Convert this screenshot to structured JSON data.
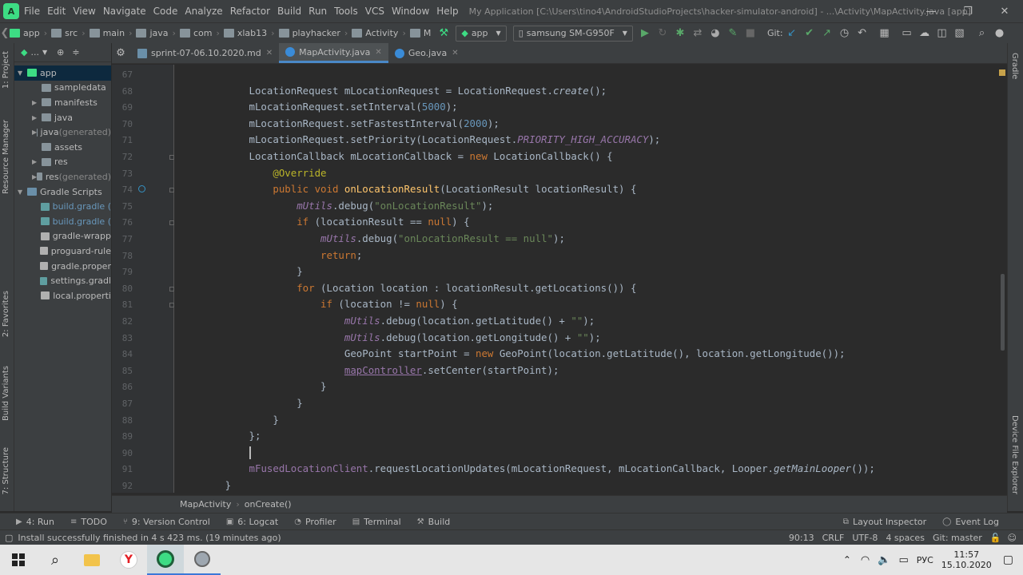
{
  "menu": [
    "File",
    "Edit",
    "View",
    "Navigate",
    "Code",
    "Analyze",
    "Refactor",
    "Build",
    "Run",
    "Tools",
    "VCS",
    "Window",
    "Help"
  ],
  "window_title": "My Application [C:\\Users\\tino4\\AndroidStudioProjects\\hacker-simulator-android] - ...\\Activity\\MapActivity.java [app]",
  "breadcrumbs": [
    "app",
    "src",
    "main",
    "java",
    "com",
    "xlab13",
    "playhacker",
    "Activity",
    "M"
  ],
  "run_config": "app",
  "device": "samsung SM-G950F",
  "git_label": "Git:",
  "project_view": "...",
  "project_tree": [
    {
      "label": "app",
      "level": 0,
      "arrow": "▼",
      "color": "#3ddc84",
      "selected": true
    },
    {
      "label": "sampledata",
      "level": 1,
      "arrow": "",
      "color": "#87939a"
    },
    {
      "label": "manifests",
      "level": 1,
      "arrow": "▶",
      "color": "#87939a"
    },
    {
      "label": "java",
      "level": 1,
      "arrow": "▶",
      "color": "#87939a"
    },
    {
      "label": "java",
      "suffix": " (generated)",
      "level": 1,
      "arrow": "▶",
      "color": "#87939a"
    },
    {
      "label": "assets",
      "level": 1,
      "arrow": "",
      "color": "#87939a"
    },
    {
      "label": "res",
      "level": 1,
      "arrow": "▶",
      "color": "#87939a"
    },
    {
      "label": "res",
      "suffix": " (generated)",
      "level": 1,
      "arrow": "▶",
      "color": "#87939a"
    },
    {
      "label": "Gradle Scripts",
      "level": 0,
      "arrow": "▼",
      "color": "#6a8fa8"
    },
    {
      "label": "build.gradle (",
      "level": 1,
      "arrow": "",
      "color": "#5f9ea0",
      "blue": true
    },
    {
      "label": "build.gradle (",
      "level": 1,
      "arrow": "",
      "color": "#5f9ea0",
      "blue": true
    },
    {
      "label": "gradle-wrapp",
      "level": 1,
      "arrow": "",
      "color": "#b0b0b0"
    },
    {
      "label": "proguard-rule",
      "level": 1,
      "arrow": "",
      "color": "#b0b0b0"
    },
    {
      "label": "gradle.proper",
      "level": 1,
      "arrow": "",
      "color": "#b0b0b0"
    },
    {
      "label": "settings.gradl",
      "level": 1,
      "arrow": "",
      "color": "#5f9ea0"
    },
    {
      "label": "local.properti",
      "level": 1,
      "arrow": "",
      "color": "#b0b0b0"
    }
  ],
  "left_tabs": [
    "1: Project",
    "Resource Manager",
    "2: Favorites",
    "Build Variants",
    "7: Structure"
  ],
  "right_tabs": [
    "Gradle",
    "Device File Explorer"
  ],
  "editor_tabs": [
    {
      "label": "sprint-07-06.10.2020.md",
      "active": false
    },
    {
      "label": "MapActivity.java",
      "active": true
    },
    {
      "label": "Geo.java",
      "active": false
    }
  ],
  "code_lines": [
    {
      "n": "67",
      "html": ""
    },
    {
      "n": "68",
      "html": "            LocationRequest mLocationRequest = LocationRequest.<span class=\"st\">create</span>();"
    },
    {
      "n": "69",
      "html": "            mLocationRequest.setInterval(<span class=\"num\">5000</span>);"
    },
    {
      "n": "70",
      "html": "            mLocationRequest.setFastestInterval(<span class=\"num\">2000</span>);"
    },
    {
      "n": "71",
      "html": "            mLocationRequest.setPriority(LocationRequest.<span class=\"fld\">PRIORITY_HIGH_ACCURACY</span>);"
    },
    {
      "n": "72",
      "html": "            LocationCallback mLocationCallback = <span class=\"kw\">new</span> LocationCallback() {"
    },
    {
      "n": "73",
      "html": "                <span class=\"ann\">@Override</span>"
    },
    {
      "n": "74",
      "html": "                <span class=\"kw\">public void</span> <span class=\"fn\">onLocationResult</span>(LocationResult locationResult) {"
    },
    {
      "n": "75",
      "html": "                    <span class=\"fld\">mUtils</span>.debug(<span class=\"str\">\"onLocationResult\"</span>);"
    },
    {
      "n": "76",
      "html": "                    <span class=\"kw\">if</span> (locationResult == <span class=\"kw\">null</span>) {"
    },
    {
      "n": "77",
      "html": "                        <span class=\"fld\">mUtils</span>.debug(<span class=\"str\">\"onLocationResult == null\"</span>);"
    },
    {
      "n": "78",
      "html": "                        <span class=\"kw\">return</span>;"
    },
    {
      "n": "79",
      "html": "                    }"
    },
    {
      "n": "80",
      "html": "                    <span class=\"kw\">for</span> (Location location : locationResult.getLocations()) {"
    },
    {
      "n": "81",
      "html": "                        <span class=\"kw\">if</span> (location != <span class=\"kw\">null</span>) {"
    },
    {
      "n": "82",
      "html": "                            <span class=\"fld\">mUtils</span>.debug(location.getLatitude() + <span class=\"str\">\"\"</span>);"
    },
    {
      "n": "83",
      "html": "                            <span class=\"fld\">mUtils</span>.debug(location.getLongitude() + <span class=\"str\">\"\"</span>);"
    },
    {
      "n": "84",
      "html": "                            GeoPoint startPoint = <span class=\"kw\">new</span> GeoPoint(location.getLatitude(), location.getLongitude());"
    },
    {
      "n": "85",
      "html": "                            <span class=\"mfld ul\">mapController</span>.setCenter(startPoint);"
    },
    {
      "n": "86",
      "html": "                        }"
    },
    {
      "n": "87",
      "html": "                    }"
    },
    {
      "n": "88",
      "html": "                }"
    },
    {
      "n": "89",
      "html": "            };"
    },
    {
      "n": "90",
      "html": ""
    },
    {
      "n": "91",
      "html": "            <span class=\"mfld\">mFusedLocationClient</span>.requestLocationUpdates(mLocationRequest, mLocationCallback, Looper.<span class=\"st\">getMainLooper</span>());"
    },
    {
      "n": "92",
      "html": "        }"
    }
  ],
  "editor_breadcrumb": [
    "MapActivity",
    "onCreate()"
  ],
  "bottom_tools": [
    {
      "icon": "▶",
      "label": "4: Run"
    },
    {
      "icon": "≡",
      "label": "TODO"
    },
    {
      "icon": "⑂",
      "label": "9: Version Control"
    },
    {
      "icon": "▣",
      "label": "6: Logcat"
    },
    {
      "icon": "◔",
      "label": "Profiler"
    },
    {
      "icon": "▤",
      "label": "Terminal"
    },
    {
      "icon": "⚒",
      "label": "Build"
    }
  ],
  "bottom_right_tools": [
    {
      "icon": "⧉",
      "label": "Layout Inspector"
    },
    {
      "icon": "◯",
      "label": "Event Log"
    }
  ],
  "status": {
    "message": "Install successfully finished in 4 s 423 ms. (19 minutes ago)",
    "position": "90:13",
    "line_sep": "CRLF",
    "encoding": "UTF-8",
    "indent": "4 spaces",
    "git": "Git: master"
  },
  "taskbar": {
    "lang": "РУС",
    "time": "11:57",
    "date": "15.10.2020"
  }
}
